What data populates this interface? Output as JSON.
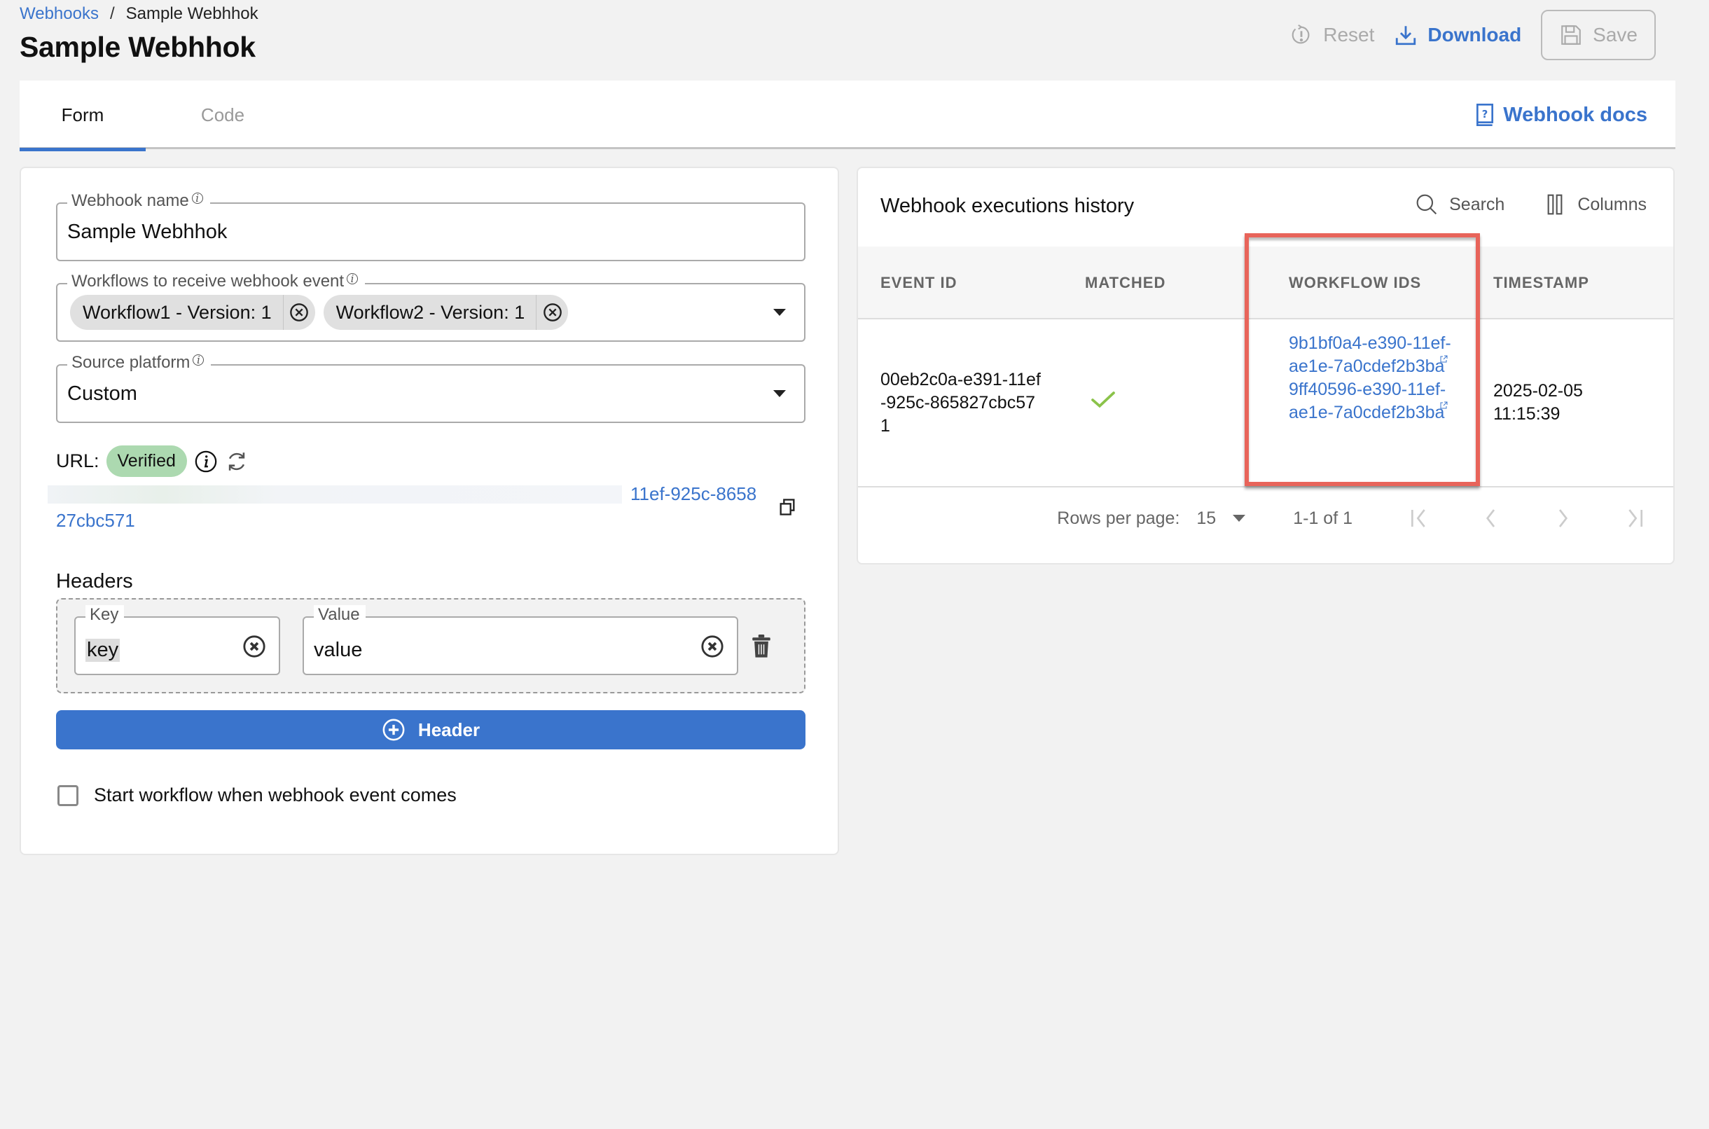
{
  "breadcrumb": {
    "parent": "Webhooks",
    "separator": "/",
    "current": "Sample Webhhok"
  },
  "page_title": "Sample Webhhok",
  "actions": {
    "reset": {
      "label": "Reset",
      "icon": "reset-icon",
      "enabled": false
    },
    "download": {
      "label": "Download",
      "icon": "download-icon",
      "enabled": true
    },
    "save": {
      "label": "Save",
      "icon": "floppy-disk-icon",
      "enabled": false
    }
  },
  "tabs": [
    {
      "label": "Form",
      "active": true
    },
    {
      "label": "Code",
      "active": false
    }
  ],
  "docs_link": {
    "label": "Webhook docs",
    "icon": "help-book-icon"
  },
  "form": {
    "webhook_name": {
      "label": "Webhook name",
      "value": "Sample Webhhok"
    },
    "workflows": {
      "label": "Workflows to receive webhook event",
      "chips": [
        "Workflow1 - Version: 1",
        "Workflow2 - Version: 1"
      ]
    },
    "source_platform": {
      "label": "Source platform",
      "value": "Custom"
    },
    "url": {
      "label": "URL:",
      "status": "Verified",
      "value_visible_line1": "11ef-925c-8658",
      "value_visible_line2": "27cbc571"
    },
    "headers": {
      "title": "Headers",
      "rows": [
        {
          "key_label": "Key",
          "key": "key",
          "value_label": "Value",
          "value": "value"
        }
      ],
      "add_button": "Header"
    },
    "start_workflow": {
      "label": "Start workflow when webhook event comes",
      "checked": false
    }
  },
  "history": {
    "title": "Webhook executions history",
    "search_label": "Search",
    "columns_label": "Columns",
    "columns": [
      "EVENT ID",
      "MATCHED",
      "WORKFLOW IDS",
      "TIMESTAMP"
    ],
    "rows": [
      {
        "event_id": "00eb2c0a-e391-11ef-925c-865827cbc571",
        "matched": true,
        "workflow_ids": [
          "9b1bf0a4-e390-11ef-ae1e-7a0cdef2b3ba",
          "9ff40596-e390-11ef-ae1e-7a0cdef2b3ba"
        ],
        "timestamp_date": "2025-02-05",
        "timestamp_time": "11:15:39"
      }
    ],
    "pagination": {
      "rows_per_page_label": "Rows per page:",
      "rows_per_page": "15",
      "range": "1-1 of 1"
    }
  },
  "colors": {
    "accent": "#3a74cc",
    "verified_badge": "#acd9b0",
    "check": "#8bc34a",
    "highlight": "#e8645a"
  }
}
